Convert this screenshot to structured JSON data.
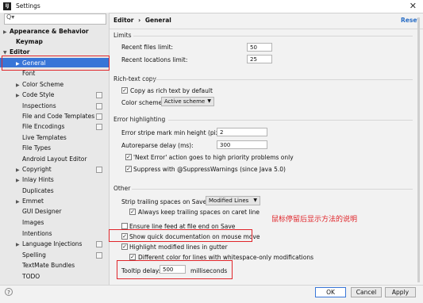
{
  "window": {
    "title": "Settings",
    "app_icon_text": "IJ",
    "close_glyph": "✕"
  },
  "search": {
    "placeholder": "Q▾",
    "value": ""
  },
  "sidebar": {
    "items": [
      {
        "label": "Appearance & Behavior",
        "arrow": "▶",
        "bold": true
      },
      {
        "label": "Keymap",
        "arrow": "",
        "bold": true
      },
      {
        "label": "Editor",
        "arrow": "▼",
        "bold": true
      },
      {
        "label": "General",
        "arrow": "▶",
        "selected": true
      },
      {
        "label": "Font",
        "arrow": ""
      },
      {
        "label": "Color Scheme",
        "arrow": "▶"
      },
      {
        "label": "Code Style",
        "arrow": "▶"
      },
      {
        "label": "Inspections",
        "arrow": ""
      },
      {
        "label": "File and Code Templates",
        "arrow": ""
      },
      {
        "label": "File Encodings",
        "arrow": ""
      },
      {
        "label": "Live Templates",
        "arrow": ""
      },
      {
        "label": "File Types",
        "arrow": ""
      },
      {
        "label": "Android Layout Editor",
        "arrow": ""
      },
      {
        "label": "Copyright",
        "arrow": "▶"
      },
      {
        "label": "Inlay Hints",
        "arrow": "▶"
      },
      {
        "label": "Duplicates",
        "arrow": ""
      },
      {
        "label": "Emmet",
        "arrow": "▶"
      },
      {
        "label": "GUI Designer",
        "arrow": ""
      },
      {
        "label": "Images",
        "arrow": ""
      },
      {
        "label": "Intentions",
        "arrow": ""
      },
      {
        "label": "Language Injections",
        "arrow": "▶"
      },
      {
        "label": "Spelling",
        "arrow": ""
      },
      {
        "label": "TextMate Bundles",
        "arrow": ""
      },
      {
        "label": "TODO",
        "arrow": ""
      }
    ]
  },
  "breadcrumb": {
    "parent": "Editor",
    "separator": "›",
    "current": "General",
    "reset": "Reset"
  },
  "limits": {
    "title": "Limits",
    "recent_files_label": "Recent files limit:",
    "recent_files_value": "50",
    "recent_locations_label": "Recent locations limit:",
    "recent_locations_value": "25"
  },
  "rich_text": {
    "title": "Rich-text copy",
    "copy_label": "Copy as rich text by default",
    "scheme_label": "Color scheme:",
    "scheme_value": "Active scheme"
  },
  "error_highlighting": {
    "title": "Error highlighting",
    "stripe_label": "Error stripe mark min height (pixels):",
    "stripe_value": "2",
    "autoreparse_label": "Autoreparse delay (ms):",
    "autoreparse_value": "300",
    "next_error_label": "'Next Error' action goes to high priority problems only",
    "suppress_label": "Suppress with @SuppressWarnings (since Java 5.0)"
  },
  "other": {
    "title": "Other",
    "strip_label": "Strip trailing spaces on Save:",
    "strip_value": "Modified Lines",
    "keep_trailing_label": "Always keep trailing spaces on caret line",
    "ensure_lf_label": "Ensure line feed at file end on Save",
    "quick_doc_label": "Show quick documentation on mouse move",
    "highlight_lines_label": "Highlight modified lines in gutter",
    "different_color_label": "Different color for lines with whitespace-only modifications",
    "tooltip_label": "Tooltip delay:",
    "tooltip_value": "500",
    "tooltip_unit": "milliseconds"
  },
  "annotation": "鼠标停留后显示方法的说明",
  "footer": {
    "ok": "OK",
    "cancel": "Cancel",
    "apply": "Apply",
    "help": "?"
  },
  "colors": {
    "selection": "#3875d7",
    "highlight_box": "#e0262b",
    "link": "#2a6ec5"
  }
}
